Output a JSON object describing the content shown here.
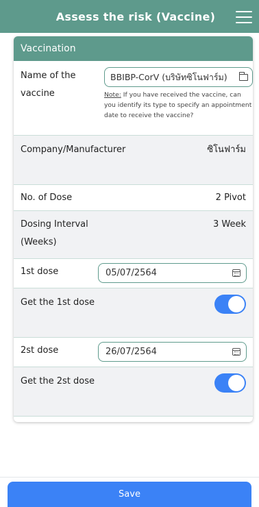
{
  "header": {
    "title": "Assess the risk (Vaccine)",
    "header_color": "#5e9a8c"
  },
  "card": {
    "title": "Vaccination",
    "vaccine_name": {
      "label": "Name of the vaccine",
      "value": "BBIBP-CorV (บริษัทซิโนฟาร์ม)",
      "note_label": "Note:",
      "note_text": " If you have received the vaccine, can you identify its type to specify an appointment date to receive the vaccine?"
    },
    "company": {
      "label": "Company/Manufacturer",
      "value": "ซิโนฟาร์ม"
    },
    "dose_count": {
      "label": "No. of Dose",
      "value": "2 Pivot"
    },
    "interval": {
      "label": "Dosing Interval (Weeks)",
      "value": "3 Week"
    },
    "first_dose": {
      "label": "1st dose",
      "value": "05/07/2564"
    },
    "get_first": {
      "label": "Get the 1st dose",
      "checked": true
    },
    "second_dose": {
      "label": "2st dose",
      "value": "26/07/2564"
    },
    "get_second": {
      "label": "Get the 2st dose",
      "checked": true
    }
  },
  "footer": {
    "save_label": "Save",
    "button_color": "#3b82f6"
  }
}
